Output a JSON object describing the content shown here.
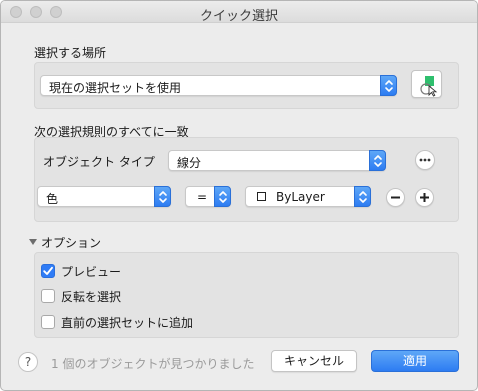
{
  "window": {
    "title": "クイック選択"
  },
  "sections": {
    "select_location_label": "選択する場所",
    "rules_label": "次の選択規則のすべてに一致",
    "options_label": "オプション"
  },
  "location": {
    "value": "現在の選択セットを使用"
  },
  "rules": {
    "object_type_label": "オブジェクト タイプ",
    "object_type_value": "線分",
    "property_value": "色",
    "operator_value": "=",
    "color_value": "ByLayer"
  },
  "options": {
    "preview": {
      "label": "プレビュー",
      "checked": true
    },
    "invert": {
      "label": "反転を選択",
      "checked": false
    },
    "append": {
      "label": "直前の選択セットに追加",
      "checked": false
    }
  },
  "footer": {
    "help_label": "?",
    "status": "1 個のオブジェクトが見つかりました",
    "cancel_label": "キャンセル",
    "apply_label": "適用"
  },
  "icons": {
    "close": "close-traffic-light-icon",
    "minimize": "minimize-traffic-light-icon",
    "zoom": "zoom-traffic-light-icon",
    "pick": "select-objects-icon",
    "more": "ellipsis-icon",
    "remove": "minus-icon",
    "add": "plus-icon",
    "disclosure": "disclosure-triangle-icon",
    "check": "checkmark-icon",
    "stepper": "up-down-chevron-icon",
    "swatch": "color-swatch-icon"
  },
  "colors": {
    "accent": "#2f7cf6",
    "panel": "#e3e3e3",
    "window": "#ececec",
    "status_text": "#9a9a9a"
  }
}
